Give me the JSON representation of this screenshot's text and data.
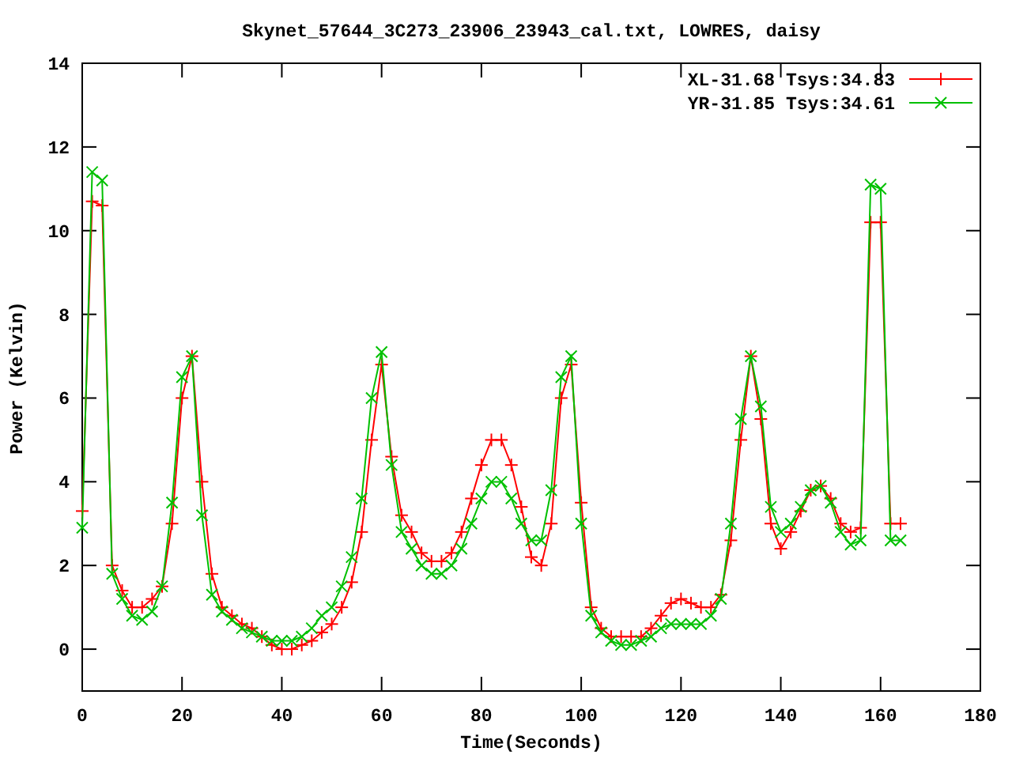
{
  "chart_data": {
    "type": "line",
    "title": "Skynet_57644_3C273_23906_23943_cal.txt, LOWRES, daisy",
    "xlabel": "Time(Seconds)",
    "ylabel": "Power (Kelvin)",
    "x": [
      0,
      2,
      4,
      6,
      8,
      10,
      12,
      14,
      16,
      18,
      20,
      22,
      24,
      26,
      28,
      30,
      32,
      34,
      36,
      38,
      40,
      42,
      44,
      46,
      48,
      50,
      52,
      54,
      56,
      58,
      60,
      62,
      64,
      66,
      68,
      70,
      72,
      74,
      76,
      78,
      80,
      82,
      84,
      86,
      88,
      90,
      92,
      94,
      96,
      98,
      100,
      102,
      104,
      106,
      108,
      110,
      112,
      114,
      116,
      118,
      120,
      122,
      124,
      126,
      128,
      130,
      132,
      134,
      136,
      138,
      140,
      142,
      144,
      146,
      148,
      150,
      152,
      154,
      156,
      158,
      160,
      162,
      164
    ],
    "series": [
      {
        "name": "XL-31.68 Tsys:34.83",
        "color": "#ff0000",
        "marker": "+",
        "values": [
          3.3,
          10.7,
          10.6,
          2.0,
          1.4,
          1.0,
          1.0,
          1.2,
          1.5,
          3.0,
          6.0,
          7.0,
          4.0,
          1.8,
          1.0,
          0.8,
          0.6,
          0.5,
          0.3,
          0.1,
          0.0,
          0.0,
          0.1,
          0.2,
          0.4,
          0.6,
          1.0,
          1.6,
          2.8,
          5.0,
          6.8,
          4.6,
          3.2,
          2.8,
          2.3,
          2.1,
          2.1,
          2.3,
          2.8,
          3.6,
          4.4,
          5.0,
          5.0,
          4.4,
          3.4,
          2.2,
          2.0,
          3.0,
          6.0,
          6.8,
          3.5,
          1.0,
          0.5,
          0.3,
          0.3,
          0.3,
          0.3,
          0.5,
          0.8,
          1.1,
          1.2,
          1.1,
          1.0,
          1.0,
          1.3,
          2.6,
          5.0,
          7.0,
          5.5,
          3.0,
          2.4,
          2.8,
          3.3,
          3.8,
          3.9,
          3.6,
          3.0,
          2.8,
          2.9,
          10.2,
          10.2,
          3.0,
          3.0
        ]
      },
      {
        "name": "YR-31.85 Tsys:34.61",
        "color": "#00c000",
        "marker": "x",
        "values": [
          2.9,
          11.4,
          11.2,
          1.8,
          1.2,
          0.8,
          0.7,
          0.9,
          1.5,
          3.5,
          6.5,
          7.0,
          3.2,
          1.3,
          0.9,
          0.7,
          0.5,
          0.4,
          0.3,
          0.2,
          0.2,
          0.2,
          0.3,
          0.5,
          0.8,
          1.0,
          1.5,
          2.2,
          3.6,
          6.0,
          7.1,
          4.4,
          2.8,
          2.4,
          2.0,
          1.8,
          1.8,
          2.0,
          2.4,
          3.0,
          3.6,
          4.0,
          4.0,
          3.6,
          3.0,
          2.6,
          2.6,
          3.8,
          6.5,
          7.0,
          3.0,
          0.8,
          0.4,
          0.2,
          0.1,
          0.1,
          0.2,
          0.3,
          0.5,
          0.6,
          0.6,
          0.6,
          0.6,
          0.8,
          1.2,
          3.0,
          5.5,
          7.0,
          5.8,
          3.4,
          2.8,
          3.0,
          3.4,
          3.8,
          3.9,
          3.5,
          2.8,
          2.5,
          2.6,
          11.1,
          11.0,
          2.6,
          2.6
        ]
      }
    ],
    "legend": true,
    "xlim": [
      0,
      180
    ],
    "ylim": [
      -1,
      14
    ],
    "xticks": [
      0,
      20,
      40,
      60,
      80,
      100,
      120,
      140,
      160,
      180
    ],
    "yticks": [
      0,
      2,
      4,
      6,
      8,
      10,
      12,
      14
    ]
  }
}
